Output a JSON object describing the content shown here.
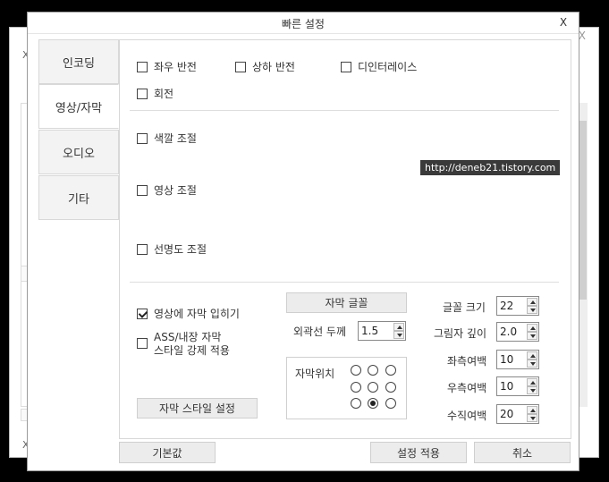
{
  "dialog": {
    "title": "빠른 설정",
    "close": "X"
  },
  "background": {
    "close": "X",
    "x_left": "X",
    "x_bottom": "X"
  },
  "tabs": [
    {
      "label": "인코딩"
    },
    {
      "label": "영상/자막"
    },
    {
      "label": "오디오"
    },
    {
      "label": "기타"
    }
  ],
  "video": {
    "flip_h": "좌우 반전",
    "flip_v": "상하 반전",
    "deinterlace": "디인터레이스",
    "rotate": "회전",
    "color_adjust": "색깔 조절",
    "video_adjust": "영상 조절",
    "sharpness_adjust": "선명도 조절"
  },
  "watermark": "http://deneb21.tistory.com",
  "subtitle": {
    "burn_in": "영상에 자막 입히기",
    "burn_in_checked": true,
    "ass_line1": "ASS/내장 자막",
    "ass_line2": "스타일 강제 적용",
    "style_button": "자막 스타일 설정",
    "font_button": "자막 글꼴",
    "outline_label": "외곽선 두께",
    "outline_value": "1.5",
    "position_label": "자막위치",
    "position_selected": "bottom-center",
    "font_size_label": "글꼴 크기",
    "font_size_value": "22",
    "shadow_label": "그림자 깊이",
    "shadow_value": "2.0",
    "left_margin_label": "좌측여백",
    "left_margin_value": "10",
    "right_margin_label": "우측여백",
    "right_margin_value": "10",
    "vertical_margin_label": "수직여백",
    "vertical_margin_value": "20"
  },
  "footer": {
    "default": "기본값",
    "apply": "설정 적용",
    "cancel": "취소"
  }
}
